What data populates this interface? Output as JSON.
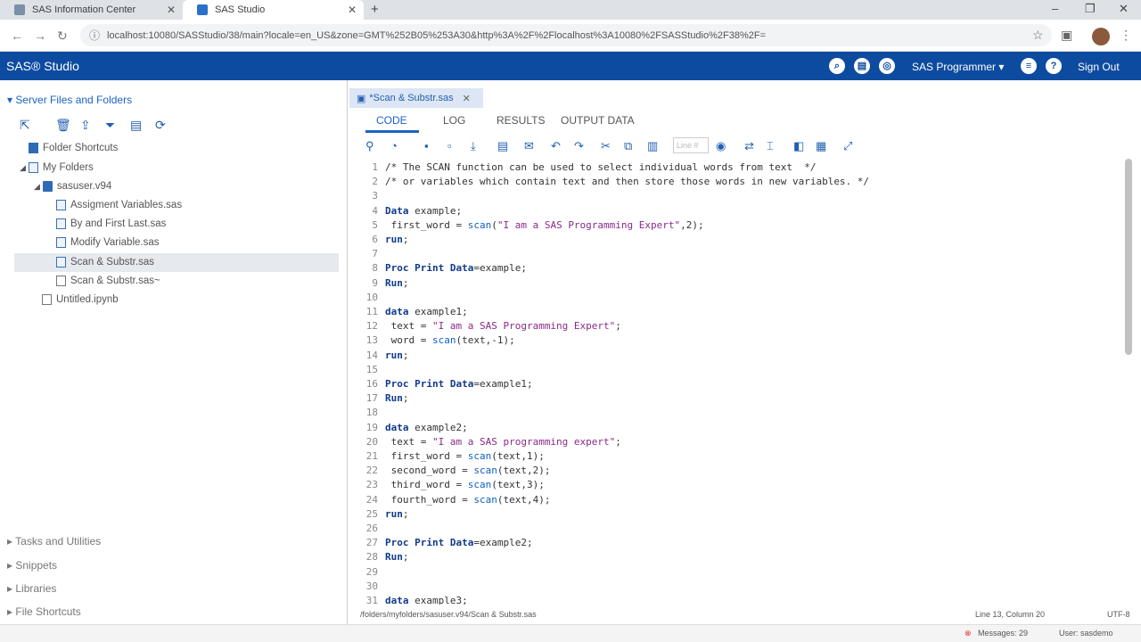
{
  "browser": {
    "tabs": [
      {
        "label": "SAS Information Center"
      },
      {
        "label": "SAS Studio"
      }
    ],
    "url": "localhost:10080/SASStudio/38/main?locale=en_US&zone=GMT%252B05%253A30&http%3A%2F%2Flocalhost%3A10080%2FSASStudio%2F38%2F="
  },
  "app": {
    "logo": "SAS® Studio",
    "user_menu": "SAS Programmer ▾",
    "sign_out": "Sign Out"
  },
  "left": {
    "section_server": "Server Files and Folders",
    "tree": [
      {
        "label": "Folder Shortcuts"
      },
      {
        "label": "My Folders"
      },
      {
        "label": "sasuser.v94"
      },
      {
        "label": "Assigment Variables.sas"
      },
      {
        "label": "By and First Last.sas"
      },
      {
        "label": "Modify Variable.sas"
      },
      {
        "label": "Scan & Substr.sas"
      },
      {
        "label": "Scan & Substr.sas~"
      },
      {
        "label": "Untitled.ipynb"
      }
    ],
    "sections": [
      "Tasks and Utilities",
      "Snippets",
      "Libraries",
      "File Shortcuts"
    ]
  },
  "editor": {
    "tab_title": "*Scan & Substr.sas",
    "subtabs": [
      "CODE",
      "LOG",
      "RESULTS",
      "OUTPUT DATA"
    ],
    "line_placeholder": "Line #",
    "lines": [
      {
        "n": "1",
        "t": "/* The SCAN function can be used to select individual words from text  */",
        "c": "comment"
      },
      {
        "n": "2",
        "t": "/* or variables which contain text and then store those words in new variables. */",
        "c": "comment"
      },
      {
        "n": "3",
        "t": "",
        "c": ""
      },
      {
        "n": "4",
        "t": "Data example;",
        "c": "kw"
      },
      {
        "n": "5",
        "t": " first_word = scan(\"I am a SAS Programming Expert\",2);",
        "c": ""
      },
      {
        "n": "6",
        "t": "run;",
        "c": "kw"
      },
      {
        "n": "7",
        "t": "",
        "c": ""
      },
      {
        "n": "8",
        "t": "Proc Print Data=example;",
        "c": "kw"
      },
      {
        "n": "9",
        "t": "Run;",
        "c": "kw"
      },
      {
        "n": "10",
        "t": "",
        "c": ""
      },
      {
        "n": "11",
        "t": "data example1;",
        "c": "kw"
      },
      {
        "n": "12",
        "t": " text = \"I am a SAS Programming Expert\";",
        "c": ""
      },
      {
        "n": "13",
        "t": " word = scan(text,-1);",
        "c": ""
      },
      {
        "n": "14",
        "t": "run;",
        "c": "kw"
      },
      {
        "n": "15",
        "t": "",
        "c": ""
      },
      {
        "n": "16",
        "t": "Proc Print Data=example1;",
        "c": "kw"
      },
      {
        "n": "17",
        "t": "Run;",
        "c": "kw"
      },
      {
        "n": "18",
        "t": "",
        "c": ""
      },
      {
        "n": "19",
        "t": "data example2;",
        "c": "kw"
      },
      {
        "n": "20",
        "t": " text = \"I am a SAS programming expert\";",
        "c": ""
      },
      {
        "n": "21",
        "t": " first_word = scan(text,1);",
        "c": ""
      },
      {
        "n": "22",
        "t": " second_word = scan(text,2);",
        "c": ""
      },
      {
        "n": "23",
        "t": " third_word = scan(text,3);",
        "c": ""
      },
      {
        "n": "24",
        "t": " fourth_word = scan(text,4);",
        "c": ""
      },
      {
        "n": "25",
        "t": "run;",
        "c": "kw"
      },
      {
        "n": "26",
        "t": "",
        "c": ""
      },
      {
        "n": "27",
        "t": "Proc Print Data=example2;",
        "c": "kw"
      },
      {
        "n": "28",
        "t": "Run;",
        "c": "kw"
      },
      {
        "n": "29",
        "t": "",
        "c": ""
      },
      {
        "n": "30",
        "t": "",
        "c": ""
      },
      {
        "n": "31",
        "t": "data example3;",
        "c": "kw"
      }
    ]
  },
  "status": {
    "path": "/folders/myfolders/sasuser.v94/Scan & Substr.sas",
    "position": "Line 13, Column 20",
    "encoding": "UTF-8",
    "messages": "Messages: 29",
    "user": "User: sasdemo"
  }
}
